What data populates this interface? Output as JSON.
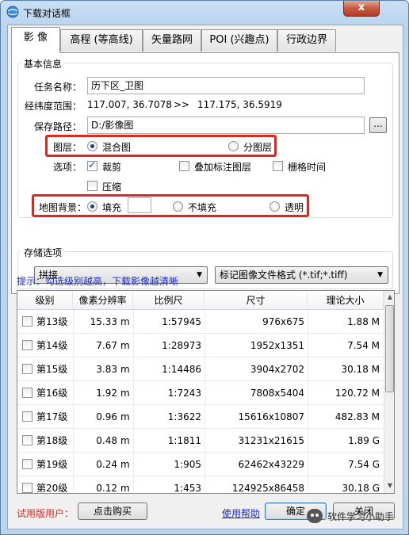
{
  "window": {
    "title": "下载对话框",
    "close_glyph": "x"
  },
  "tabs": [
    {
      "label": "影 像",
      "active": true
    },
    {
      "label": "高程 (等高线)",
      "active": false
    },
    {
      "label": "矢量路网",
      "active": false
    },
    {
      "label": "POI (兴趣点)",
      "active": false
    },
    {
      "label": "行政边界",
      "active": false
    }
  ],
  "basic": {
    "group_title": "基本信息",
    "task_name_label": "任务名称：",
    "task_name_value": "历下区_卫图",
    "latlon_label": "经纬度范围：",
    "latlon_from": "117.007, 36.7078",
    "latlon_arrow": ">>",
    "latlon_to": "117.175, 36.5919",
    "save_path_label": "保存路径：",
    "save_path_value": "D:/影像图",
    "browse_label": "...",
    "layer_label": "图层：",
    "layer_options": [
      "混合图",
      "分图层"
    ],
    "layer_selected": "混合图",
    "options_label": "选项：",
    "opt_crop": {
      "label": "裁剪",
      "checked": true
    },
    "opt_overlay": {
      "label": "叠加标注图层",
      "checked": false
    },
    "opt_grid": {
      "label": "栅格时间",
      "checked": false
    },
    "opt_compress": {
      "label": "压缩",
      "checked": false
    },
    "bg_label": "地图背景：",
    "bg_fill": "填充",
    "bg_nofill": "不填充",
    "bg_transparent": "透明",
    "bg_selected": "填充",
    "highlight_color": "#e0261f"
  },
  "storage": {
    "group_title": "存储选项",
    "mode_value": "拼接",
    "format_value": "标记图像文件格式 (*.tif;*.tiff)"
  },
  "hint": "提示：勾选级别越高，下载影像越清晰",
  "table": {
    "headers": [
      "级别",
      "像素分辨率",
      "比例尺",
      "尺寸",
      "理论大小"
    ],
    "rows": [
      {
        "level": "第13级",
        "res": "15.33",
        "unit": "m",
        "scale": "1:57945",
        "size": "976x675",
        "est": "1.88 M"
      },
      {
        "level": "第14级",
        "res": "7.67",
        "unit": "m",
        "scale": "1:28973",
        "size": "1952x1351",
        "est": "7.54 M"
      },
      {
        "level": "第15级",
        "res": "3.83",
        "unit": "m",
        "scale": "1:14486",
        "size": "3904x2702",
        "est": "30.18 M"
      },
      {
        "level": "第16级",
        "res": "1.92",
        "unit": "m",
        "scale": "1:7243",
        "size": "7808x5404",
        "est": "120.72 M"
      },
      {
        "level": "第17级",
        "res": "0.96",
        "unit": "m",
        "scale": "1:3622",
        "size": "15616x10807",
        "est": "482.83 M"
      },
      {
        "level": "第18级",
        "res": "0.48",
        "unit": "m",
        "scale": "1:1811",
        "size": "31231x21615",
        "est": "1.89 G"
      },
      {
        "level": "第19级",
        "res": "0.24",
        "unit": "m",
        "scale": "1:905",
        "size": "62462x43229",
        "est": "7.54 G"
      },
      {
        "level": "第20级",
        "res": "0.12",
        "unit": "m",
        "scale": "1:453",
        "size": "124925x86458",
        "est": "30.18 G"
      }
    ]
  },
  "footer": {
    "trial_label": "试用版用户：",
    "buy_label": "点击购买",
    "help_label": "使用帮助",
    "ok_label": "确定",
    "close_label": "关闭",
    "trial_color": "#e0261f"
  },
  "watermark": {
    "text": "软件学习小助手"
  }
}
